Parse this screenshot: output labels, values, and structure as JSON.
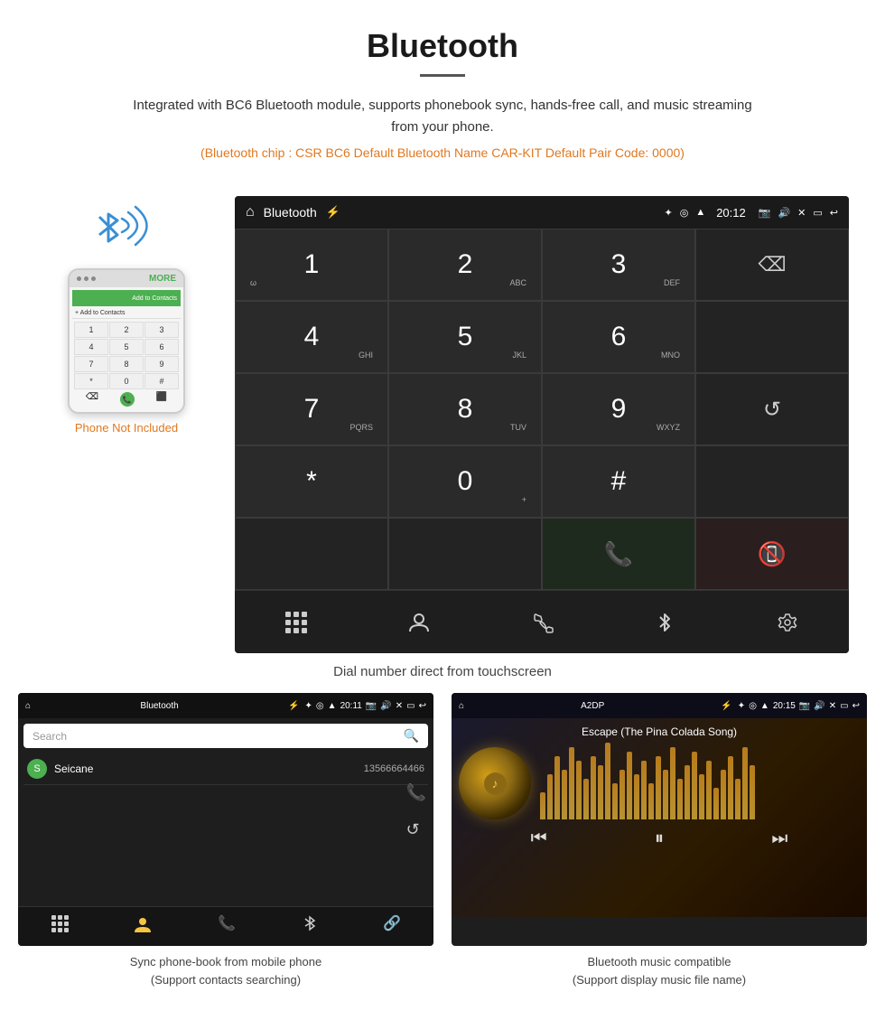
{
  "header": {
    "title": "Bluetooth",
    "description": "Integrated with BC6 Bluetooth module, supports phonebook sync, hands-free call, and music streaming from your phone.",
    "specs": "(Bluetooth chip : CSR BC6    Default Bluetooth Name CAR-KIT    Default Pair Code: 0000)"
  },
  "phone_mockup": {
    "not_included_label": "Phone Not Included",
    "keys": [
      "1",
      "2",
      "3",
      "4",
      "5",
      "6",
      "7",
      "8",
      "9",
      "*",
      "0",
      "#"
    ]
  },
  "car_screen": {
    "statusbar": {
      "title": "Bluetooth",
      "time": "20:12"
    },
    "dialpad": [
      {
        "main": "1",
        "sub": "◌◡"
      },
      {
        "main": "2",
        "sub": "ABC"
      },
      {
        "main": "3",
        "sub": "DEF"
      },
      {
        "main": "",
        "sub": ""
      },
      {
        "main": "4",
        "sub": "GHI"
      },
      {
        "main": "5",
        "sub": "JKL"
      },
      {
        "main": "6",
        "sub": "MNO"
      },
      {
        "main": "",
        "sub": ""
      },
      {
        "main": "7",
        "sub": "PQRS"
      },
      {
        "main": "8",
        "sub": "TUV"
      },
      {
        "main": "9",
        "sub": "WXYZ"
      },
      {
        "main": "",
        "sub": ""
      },
      {
        "main": "*",
        "sub": ""
      },
      {
        "main": "0",
        "sub": "+"
      },
      {
        "main": "#",
        "sub": ""
      },
      {
        "main": "",
        "sub": ""
      }
    ],
    "caption": "Dial number direct from touchscreen"
  },
  "phonebook_screen": {
    "statusbar_title": "Bluetooth",
    "statusbar_time": "20:11",
    "search_placeholder": "Search",
    "contacts": [
      {
        "initial": "S",
        "name": "Seicane",
        "phone": "13566664466"
      }
    ],
    "caption": "Sync phone-book from mobile phone\n(Support contacts searching)"
  },
  "music_screen": {
    "statusbar_title": "A2DP",
    "statusbar_time": "20:15",
    "song_title": "Escape (The Pina Colada Song)",
    "eq_bars": [
      30,
      50,
      70,
      55,
      80,
      65,
      45,
      70,
      60,
      85,
      40,
      55,
      75,
      50,
      65,
      40,
      70,
      55,
      80,
      45,
      60,
      75,
      50,
      65,
      35,
      55,
      70,
      45,
      80,
      60
    ],
    "caption": "Bluetooth music compatible\n(Support display music file name)"
  },
  "watermark": "Seicane"
}
